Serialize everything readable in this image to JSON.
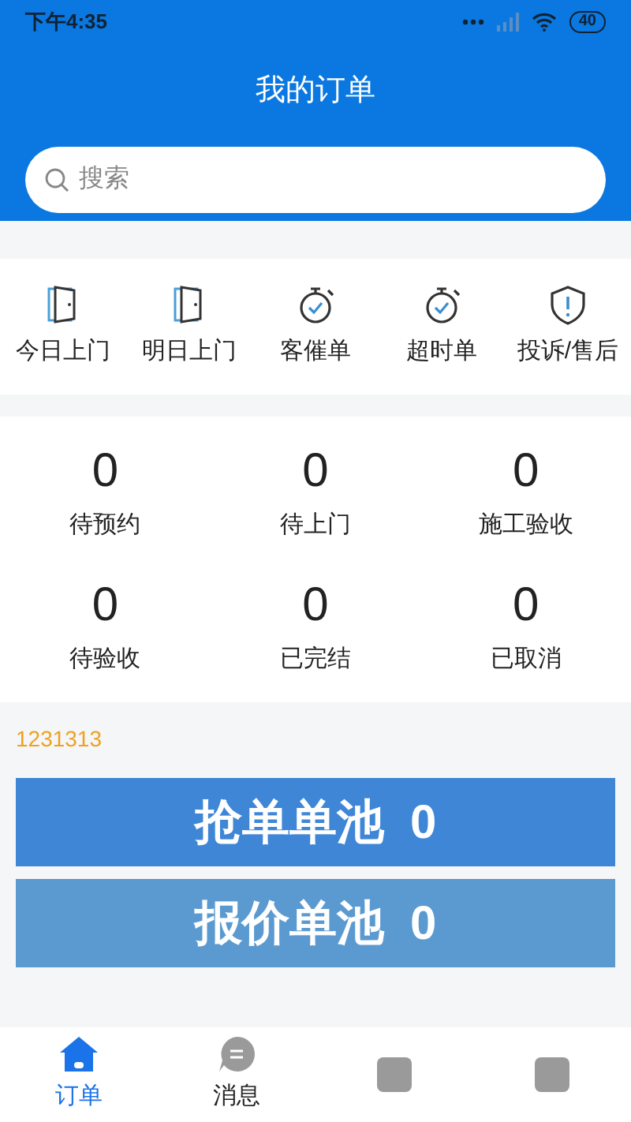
{
  "status_bar": {
    "time": "下午4:35",
    "battery": "40"
  },
  "header": {
    "title": "我的订单"
  },
  "search": {
    "placeholder": "搜索"
  },
  "shortcuts": [
    {
      "kind": "door",
      "label": "今日上门"
    },
    {
      "kind": "door",
      "label": "明日上门"
    },
    {
      "kind": "timer",
      "label": "客催单"
    },
    {
      "kind": "timer",
      "label": "超时单"
    },
    {
      "kind": "shield",
      "label": "投诉/售后"
    }
  ],
  "counts": [
    {
      "value": "0",
      "label": "待预约"
    },
    {
      "value": "0",
      "label": "待上门"
    },
    {
      "value": "0",
      "label": "施工验收"
    },
    {
      "value": "0",
      "label": "待验收"
    },
    {
      "value": "0",
      "label": "已完结"
    },
    {
      "value": "0",
      "label": "已取消"
    }
  ],
  "code": "1231313",
  "pools": [
    {
      "label": "抢单单池",
      "count": "0"
    },
    {
      "label": "报价单池",
      "count": "0"
    }
  ],
  "tabs": [
    {
      "kind": "home",
      "label": "订单",
      "selected": true
    },
    {
      "kind": "chat",
      "label": "消息",
      "selected": false
    },
    {
      "kind": "blank",
      "selected": false
    },
    {
      "kind": "blank",
      "selected": false
    }
  ]
}
